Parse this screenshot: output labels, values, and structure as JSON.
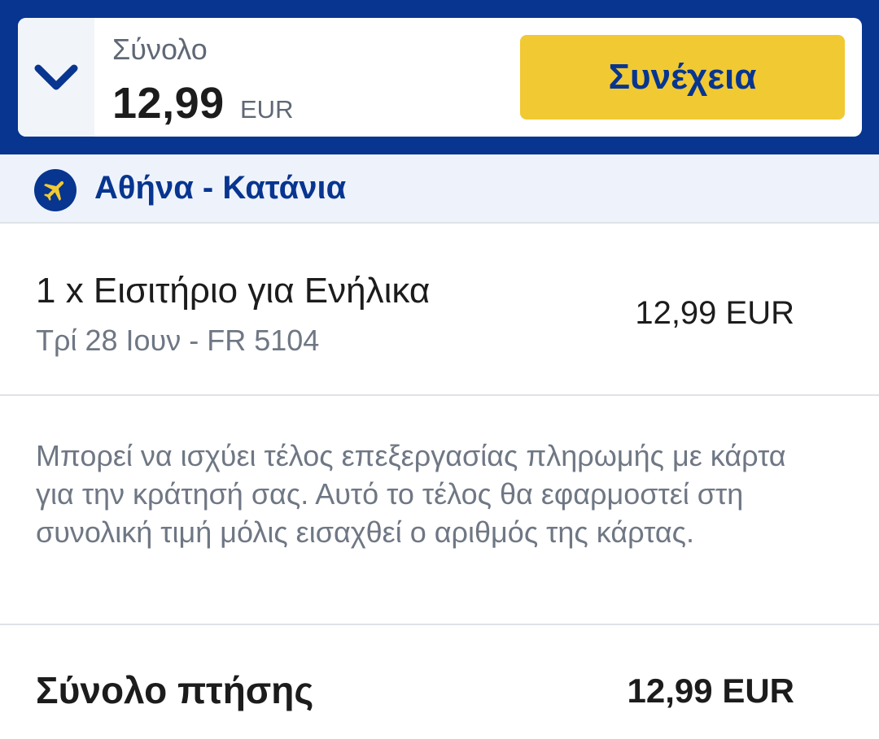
{
  "header": {
    "total_label": "Σύνολο",
    "total_amount": "12,99",
    "total_currency": "EUR",
    "continue_label": "Συνέχεια",
    "toggle_icon": "chevron-down-icon"
  },
  "route": {
    "icon": "plane-icon",
    "text": "Αθήνα - Κατάνια"
  },
  "ticket": {
    "title": "1 x Εισιτήριο για Ενήλικα",
    "subtitle": "Τρί 28 Ιουν - FR 5104",
    "price": "12,99 EUR"
  },
  "fee_note": "Μπορεί να ισχύει τέλος επεξεργασίας πληρωμής με κάρτα για την κράτησή σας. Αυτό το τέλος θα εφαρμοστεί στη συνολική τιμή μόλις εισαχθεί ο αριθμός της κάρτας.",
  "flight_total": {
    "label": "Σύνολο πτήσης",
    "amount": "12,99 EUR"
  },
  "colors": {
    "brand_blue": "#073590",
    "brand_yellow": "#f1c933"
  }
}
